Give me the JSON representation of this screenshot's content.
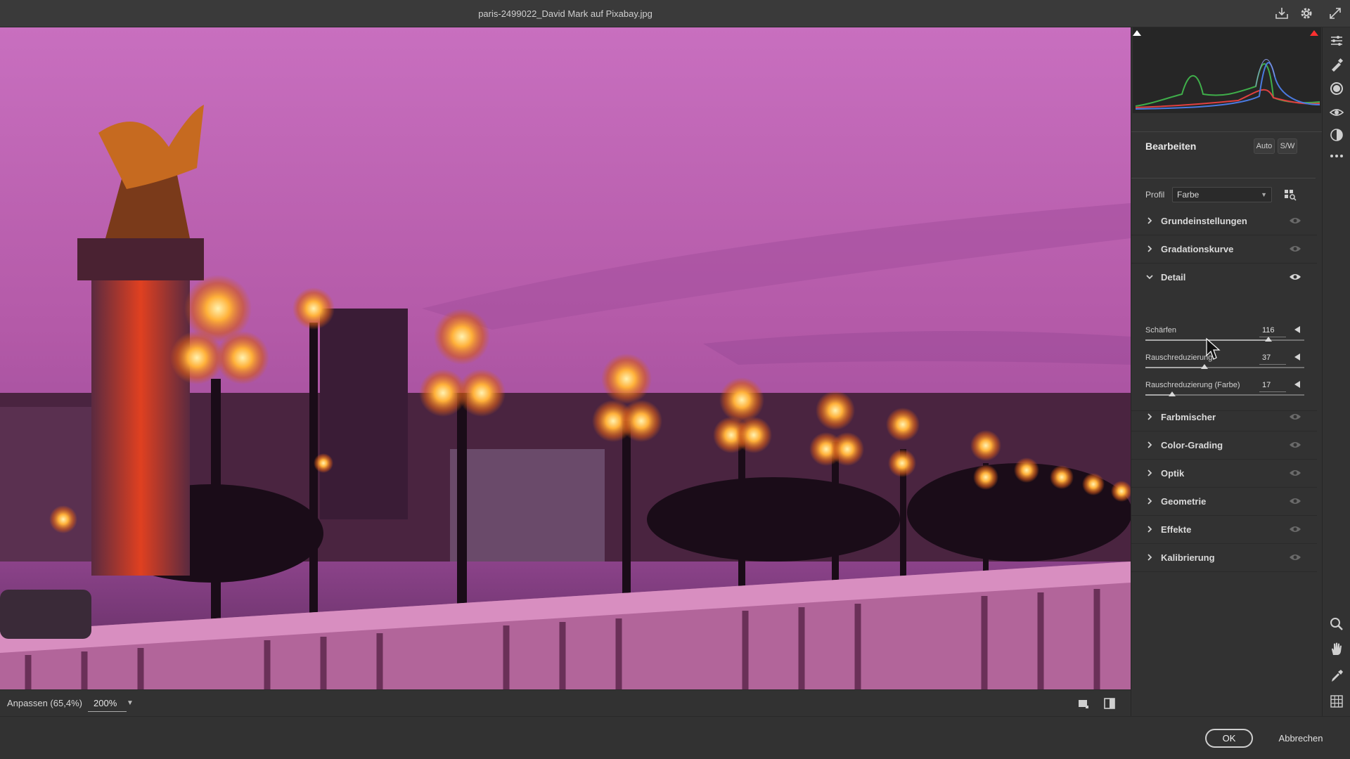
{
  "window": {
    "title": "paris-2499022_David Mark auf Pixabay.jpg"
  },
  "status": {
    "fit_label": "Anpassen (65,4%)",
    "zoom_value": "200%"
  },
  "panel": {
    "title": "Bearbeiten",
    "auto_label": "Auto",
    "bw_label": "S/W",
    "profile_label": "Profil",
    "profile_value": "Farbe"
  },
  "sections": [
    {
      "label": "Grundeinstellungen",
      "expanded": false
    },
    {
      "label": "Gradationskurve",
      "expanded": false
    },
    {
      "label": "Detail",
      "expanded": true
    },
    {
      "label": "Farbmischer",
      "expanded": false
    },
    {
      "label": "Color-Grading",
      "expanded": false
    },
    {
      "label": "Optik",
      "expanded": false
    },
    {
      "label": "Geometrie",
      "expanded": false
    },
    {
      "label": "Effekte",
      "expanded": false
    },
    {
      "label": "Kalibrierung",
      "expanded": false
    }
  ],
  "detail_sliders": [
    {
      "label": "Schärfen",
      "value": "116",
      "fraction": 0.773
    },
    {
      "label": "Rauschreduzierung",
      "value": "37",
      "fraction": 0.37
    },
    {
      "label": "Rauschreduzierung (Farbe)",
      "value": "17",
      "fraction": 0.17
    }
  ],
  "footer": {
    "ok_label": "OK",
    "cancel_label": "Abbrechen"
  },
  "colors": {
    "accent": "#d8d8d8",
    "panel_bg": "#323232",
    "sky_top": "#c86fbf",
    "lamp_glow": "#ffb13a"
  },
  "icons": [
    "save-icon",
    "gear-icon",
    "fullscreen-icon",
    "edit-sliders-icon",
    "healing-brush-icon",
    "mask-icon",
    "red-eye-icon",
    "presets-icon",
    "more-icon",
    "zoom-icon",
    "hand-icon",
    "eyedropper-icon",
    "grid-icon",
    "single-view-icon",
    "before-after-icon",
    "eye-icon",
    "profile-browser-icon"
  ]
}
